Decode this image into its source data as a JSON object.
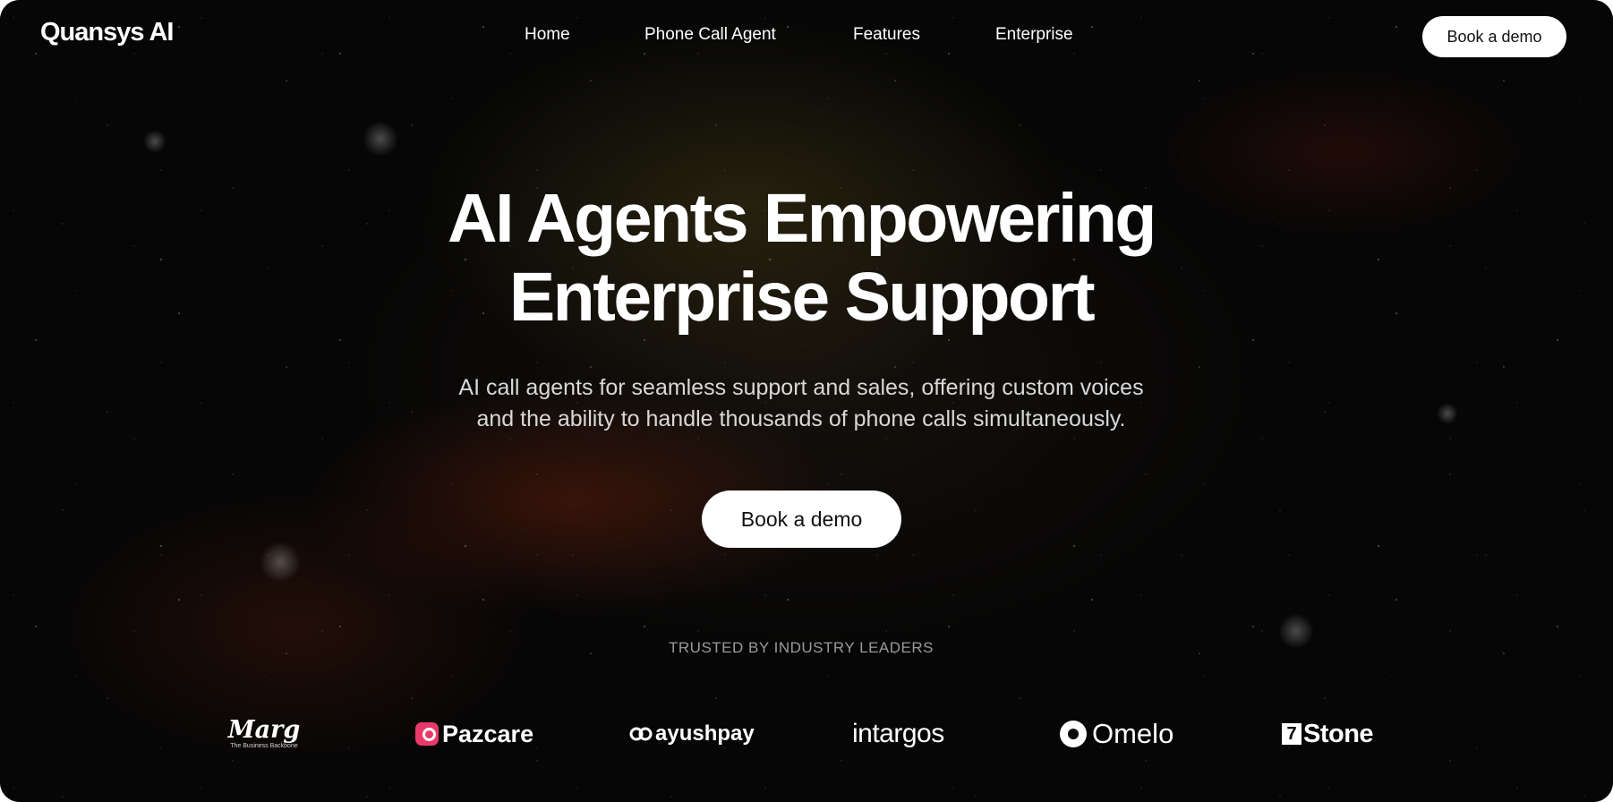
{
  "header": {
    "logo": "Quansys AI",
    "nav": [
      {
        "label": "Home"
      },
      {
        "label": "Phone Call Agent"
      },
      {
        "label": "Features"
      },
      {
        "label": "Enterprise"
      }
    ],
    "cta_label": "Book a demo"
  },
  "hero": {
    "title_line1": "AI Agents Empowering",
    "title_line2": "Enterprise Support",
    "subtitle_line1": "AI call agents for seamless support and sales, offering custom voices",
    "subtitle_line2": "and the ability to handle thousands of phone calls simultaneously.",
    "cta_label": "Book a demo"
  },
  "trusted": {
    "heading": "TRUSTED BY INDUSTRY LEADERS",
    "logos": [
      {
        "name": "Marg",
        "tagline": "The Business Backbone",
        "icon": "marg-logo"
      },
      {
        "name": "Pazcare",
        "icon": "pazcare-logo"
      },
      {
        "name": "ayushpay",
        "icon": "ayushpay-logo"
      },
      {
        "name": "intargos",
        "icon": "intargos-logo"
      },
      {
        "name": "Omelo",
        "icon": "omelo-logo"
      },
      {
        "name": "Stone",
        "icon": "stone-logo",
        "mark": "7"
      }
    ]
  },
  "colors": {
    "background": "#050505",
    "text": "#ffffff",
    "muted": "#9a9a9a",
    "button_bg": "#ffffff",
    "button_text": "#111111",
    "pazcare_accent": "#e83a6a"
  }
}
